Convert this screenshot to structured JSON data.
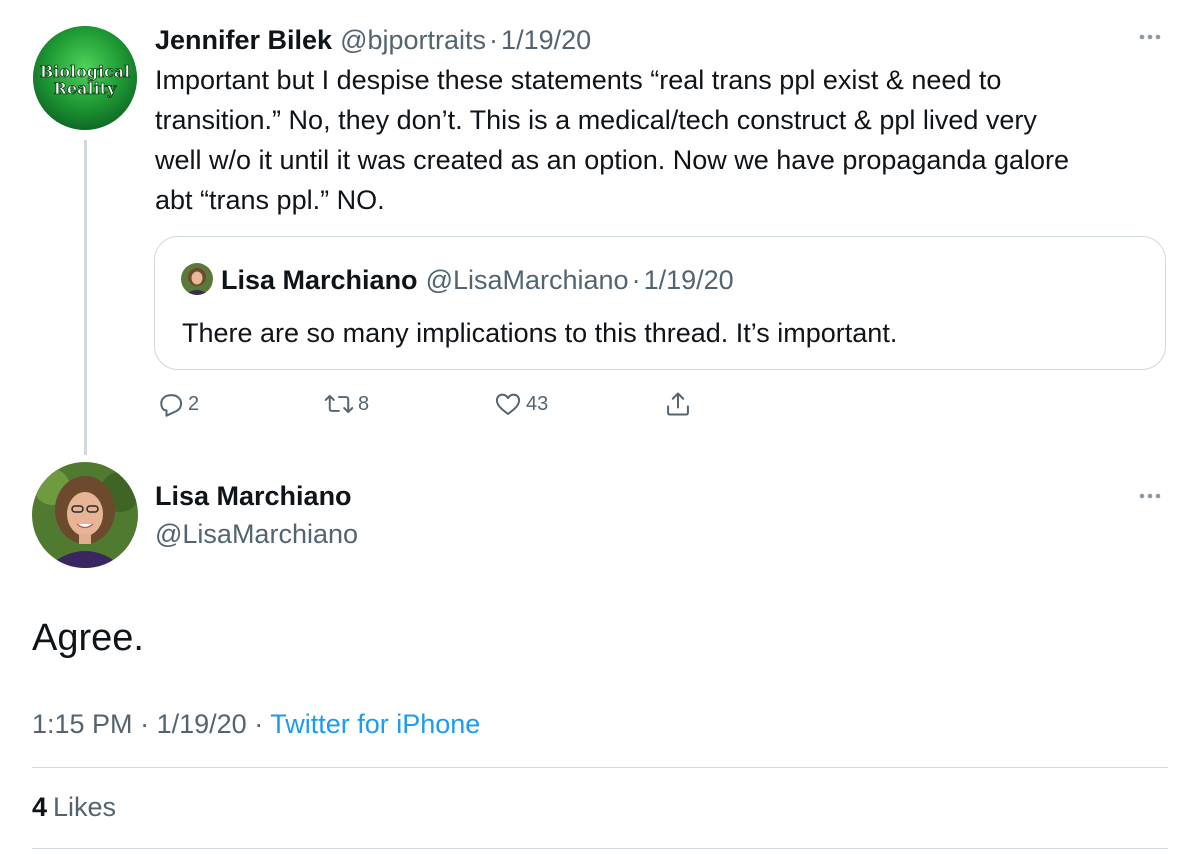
{
  "parent_tweet": {
    "author_name": "Jennifer Bilek",
    "handle": "@bjportraits",
    "separator": "·",
    "date": "1/19/20",
    "avatar_text_line1": "Biological",
    "avatar_text_line2": "Reality",
    "text_lines": [
      "Important but I despise  these statements “real trans ppl exist & need to",
      "transition.” No, they don’t. This is a medical/tech construct & ppl lived very",
      "well w/o it until it was created as an option. Now we have propaganda galore",
      "abt “trans ppl.” NO."
    ],
    "quote": {
      "author_name": "Lisa Marchiano",
      "handle": "@LisaMarchiano",
      "separator": "·",
      "date": "1/19/20",
      "text": "There are so many implications to this thread. It’s important."
    },
    "actions": {
      "reply_count": "2",
      "retweet_count": "8",
      "like_count": "43"
    }
  },
  "main_tweet": {
    "author_name": "Lisa Marchiano",
    "handle": "@LisaMarchiano",
    "text": "Agree.",
    "time": "1:15 PM",
    "separator": "·",
    "date": "1/19/20",
    "source": "Twitter for iPhone",
    "likes_count": "4",
    "likes_label": "Likes"
  },
  "colors": {
    "text_primary": "#0f1419",
    "text_secondary": "#536471",
    "link_blue": "#1d9bf0",
    "border": "#cfd9de",
    "avatar_green": "#1f9a34"
  },
  "icons": [
    "more-icon",
    "reply-icon",
    "retweet-icon",
    "like-icon",
    "share-icon"
  ]
}
